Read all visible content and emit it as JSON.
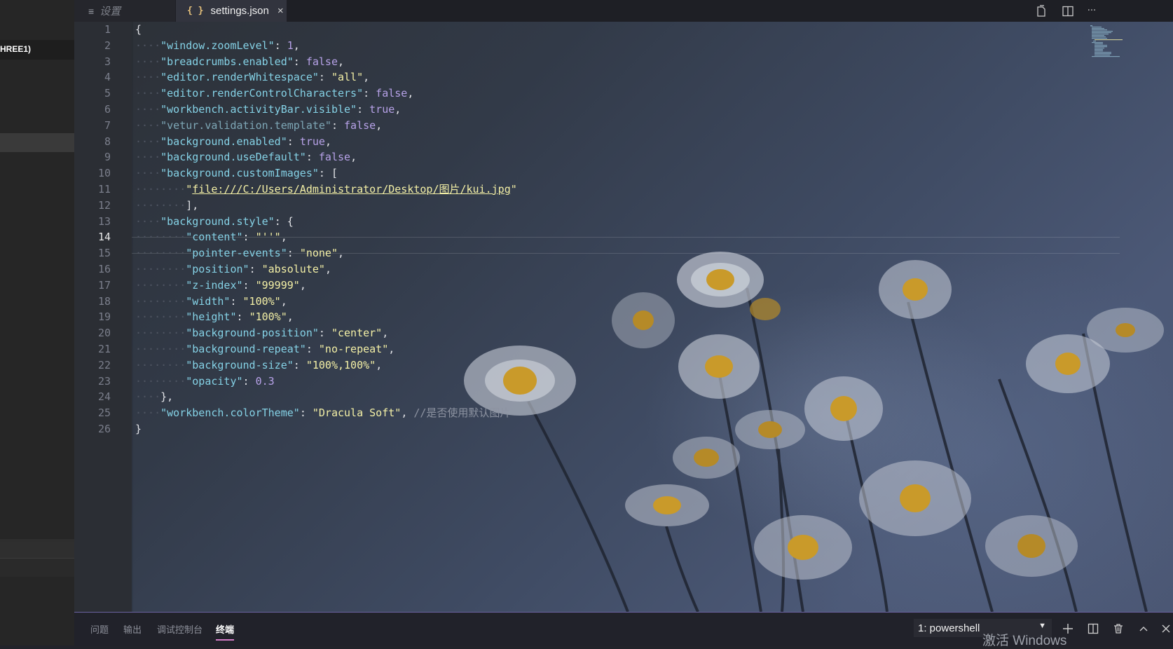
{
  "sidebar": {
    "folder_label": "HREE1)"
  },
  "tabs": [
    {
      "label": "设置",
      "icon": "list-icon",
      "active": false
    },
    {
      "label": "settings.json",
      "icon": "json-braces-icon",
      "active": true,
      "close": "×"
    }
  ],
  "title_actions": [
    "open-changes-icon",
    "split-editor-icon",
    "more-actions-icon"
  ],
  "title_actions_glyphs": {
    "more": "···"
  },
  "editor": {
    "current_line": 14,
    "line_numbers": [
      "1",
      "2",
      "3",
      "4",
      "5",
      "6",
      "7",
      "8",
      "9",
      "10",
      "11",
      "12",
      "13",
      "14",
      "15",
      "16",
      "17",
      "18",
      "19",
      "20",
      "21",
      "22",
      "23",
      "24",
      "25",
      "26"
    ],
    "lines": [
      "{",
      "    \"window.zoomLevel\": 1,",
      "    \"breadcrumbs.enabled\": false,",
      "    \"editor.renderWhitespace\": \"all\",",
      "    \"editor.renderControlCharacters\": false,",
      "    \"workbench.activityBar.visible\": true,",
      "    \"vetur.validation.template\": false,",
      "    \"background.enabled\": true,",
      "    \"background.useDefault\": false,",
      "    \"background.customImages\": [",
      "        \"file:///C:/Users/Administrator/Desktop/图片/kui.jpg\"",
      "        ],",
      "    \"background.style\": {",
      "        \"content\": \"''\",",
      "        \"pointer-events\": \"none\",",
      "        \"position\": \"absolute\",",
      "        \"z-index\": \"99999\",",
      "        \"width\": \"100%\",",
      "        \"height\": \"100%\",",
      "        \"background-position\": \"center\",",
      "        \"background-repeat\": \"no-repeat\",",
      "        \"background-size\": \"100%,100%\",",
      "        \"opacity\": 0.3",
      "    },",
      "    \"workbench.colorTheme\": \"Dracula Soft\", //是否使用默认图片",
      "}"
    ]
  },
  "panel": {
    "tabs": [
      "问题",
      "输出",
      "调试控制台",
      "终端"
    ],
    "active_tab": "终端",
    "terminal_select": "1: powershell",
    "actions": [
      "add-terminal-icon",
      "split-terminal-icon",
      "trash-icon",
      "maximize-panel-icon",
      "close-panel-icon"
    ],
    "watermark": "激活 Windows"
  },
  "colors": {
    "key": "#85d2e6",
    "string": "#f4f0a6",
    "boolean": "#b7a2e8",
    "comment": "#8d93a1",
    "panel_accent": "#d57ec9"
  }
}
